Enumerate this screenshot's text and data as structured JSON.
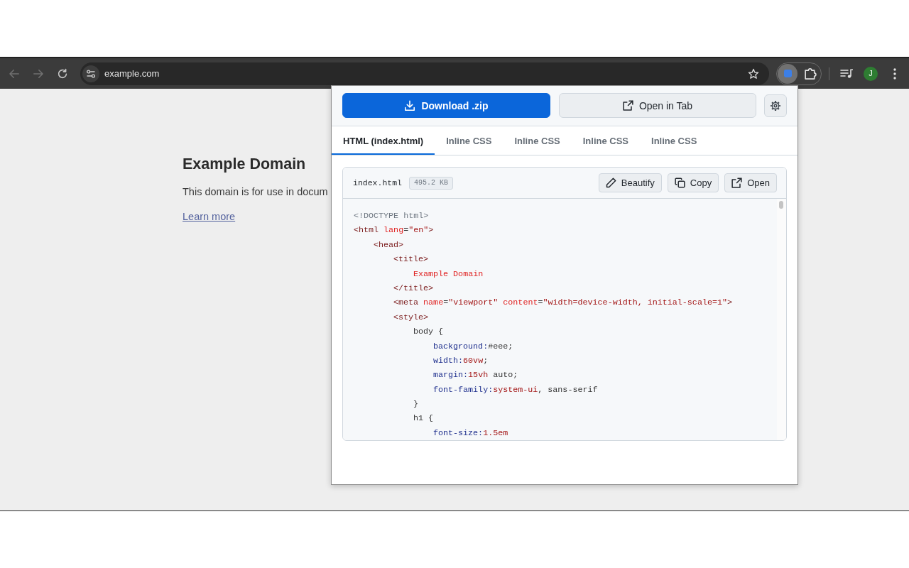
{
  "browser": {
    "nav_buttons": [
      {
        "kind": "back",
        "disabled": true
      },
      {
        "kind": "forward",
        "disabled": true
      },
      {
        "kind": "reload",
        "disabled": false
      }
    ],
    "address": {
      "url": "example.com"
    },
    "extension_button": {
      "active": true
    },
    "profile": {
      "initial": "J"
    }
  },
  "page": {
    "heading": "Example Domain",
    "paragraph": "This domain is for use in docum",
    "link": "Learn more"
  },
  "popup": {
    "actions": [
      {
        "kind": "download",
        "label": "Download .zip"
      },
      {
        "kind": "open",
        "label": "Open in Tab"
      }
    ],
    "tabs": [
      {
        "label": "HTML (index.html)",
        "selected": true
      },
      {
        "label": "Inline CSS",
        "selected": false
      },
      {
        "label": "Inline CSS",
        "selected": false
      },
      {
        "label": "Inline CSS",
        "selected": false
      },
      {
        "label": "Inline CSS",
        "selected": false
      }
    ],
    "file": {
      "name": "index.html",
      "size": "495.2 KB",
      "buttons": [
        {
          "kind": "beautify",
          "label": "Beautify"
        },
        {
          "kind": "copy",
          "label": "Copy"
        },
        {
          "kind": "open",
          "label": "Open"
        }
      ],
      "lines": [
        {
          "segments": [
            {
              "kind": "doctype",
              "text": "<!DOCTYPE html>"
            }
          ]
        },
        {
          "segments": [
            {
              "kind": "tag",
              "text": "<html "
            },
            {
              "kind": "attr",
              "text": "lang"
            },
            {
              "kind": "plain",
              "text": "="
            },
            {
              "kind": "value",
              "text": "\"en\""
            },
            {
              "kind": "tag",
              "text": ">"
            }
          ],
          "children": [
            {
              "segments": [
                {
                  "kind": "tag",
                  "text": "<head>"
                }
              ],
              "children": [
                {
                  "segments": [
                    {
                      "kind": "tag",
                      "text": "<title>"
                    }
                  ],
                  "children": [
                    {
                      "segments": [
                        {
                          "kind": "text",
                          "text": "Example Domain"
                        }
                      ]
                    }
                  ]
                },
                {
                  "segments": [
                    {
                      "kind": "tag",
                      "text": "</title>"
                    }
                  ]
                },
                {
                  "segments": [
                    {
                      "kind": "tag",
                      "text": "<meta "
                    },
                    {
                      "kind": "attr",
                      "text": "name"
                    },
                    {
                      "kind": "plain",
                      "text": "="
                    },
                    {
                      "kind": "value",
                      "text": "\"viewport\" "
                    },
                    {
                      "kind": "attr",
                      "text": "content"
                    },
                    {
                      "kind": "plain",
                      "text": "="
                    },
                    {
                      "kind": "value",
                      "text": "\"width=device-width, initial-scale=1\""
                    },
                    {
                      "kind": "tag",
                      "text": ">"
                    }
                  ]
                },
                {
                  "segments": [
                    {
                      "kind": "tag",
                      "text": "<style>"
                    }
                  ],
                  "children": [
                    {
                      "segments": [
                        {
                          "kind": "selector",
                          "text": "body {"
                        }
                      ],
                      "children": [
                        {
                          "segments": [
                            {
                              "kind": "property",
                              "text": "background:"
                            },
                            {
                              "kind": "plain",
                              "text": "#eee;"
                            }
                          ]
                        },
                        {
                          "segments": [
                            {
                              "kind": "property",
                              "text": "width:"
                            },
                            {
                              "kind": "value",
                              "text": "60vw"
                            },
                            {
                              "kind": "plain",
                              "text": ";"
                            }
                          ]
                        },
                        {
                          "segments": [
                            {
                              "kind": "property",
                              "text": "margin:"
                            },
                            {
                              "kind": "value",
                              "text": "15vh"
                            },
                            {
                              "kind": "plain",
                              "text": " auto;"
                            }
                          ]
                        },
                        {
                          "segments": [
                            {
                              "kind": "property",
                              "text": "font-family:"
                            },
                            {
                              "kind": "value",
                              "text": "system-ui"
                            },
                            {
                              "kind": "plain",
                              "text": ", sans-serif"
                            }
                          ]
                        }
                      ]
                    },
                    {
                      "segments": [
                        {
                          "kind": "selector",
                          "text": "}"
                        }
                      ]
                    },
                    {
                      "segments": [
                        {
                          "kind": "selector",
                          "text": "h1 {"
                        }
                      ],
                      "children": [
                        {
                          "segments": [
                            {
                              "kind": "property",
                              "text": "font-size:"
                            },
                            {
                              "kind": "value",
                              "text": "1.5em"
                            }
                          ]
                        }
                      ]
                    }
                  ]
                }
              ]
            }
          ]
        }
      ]
    }
  }
}
